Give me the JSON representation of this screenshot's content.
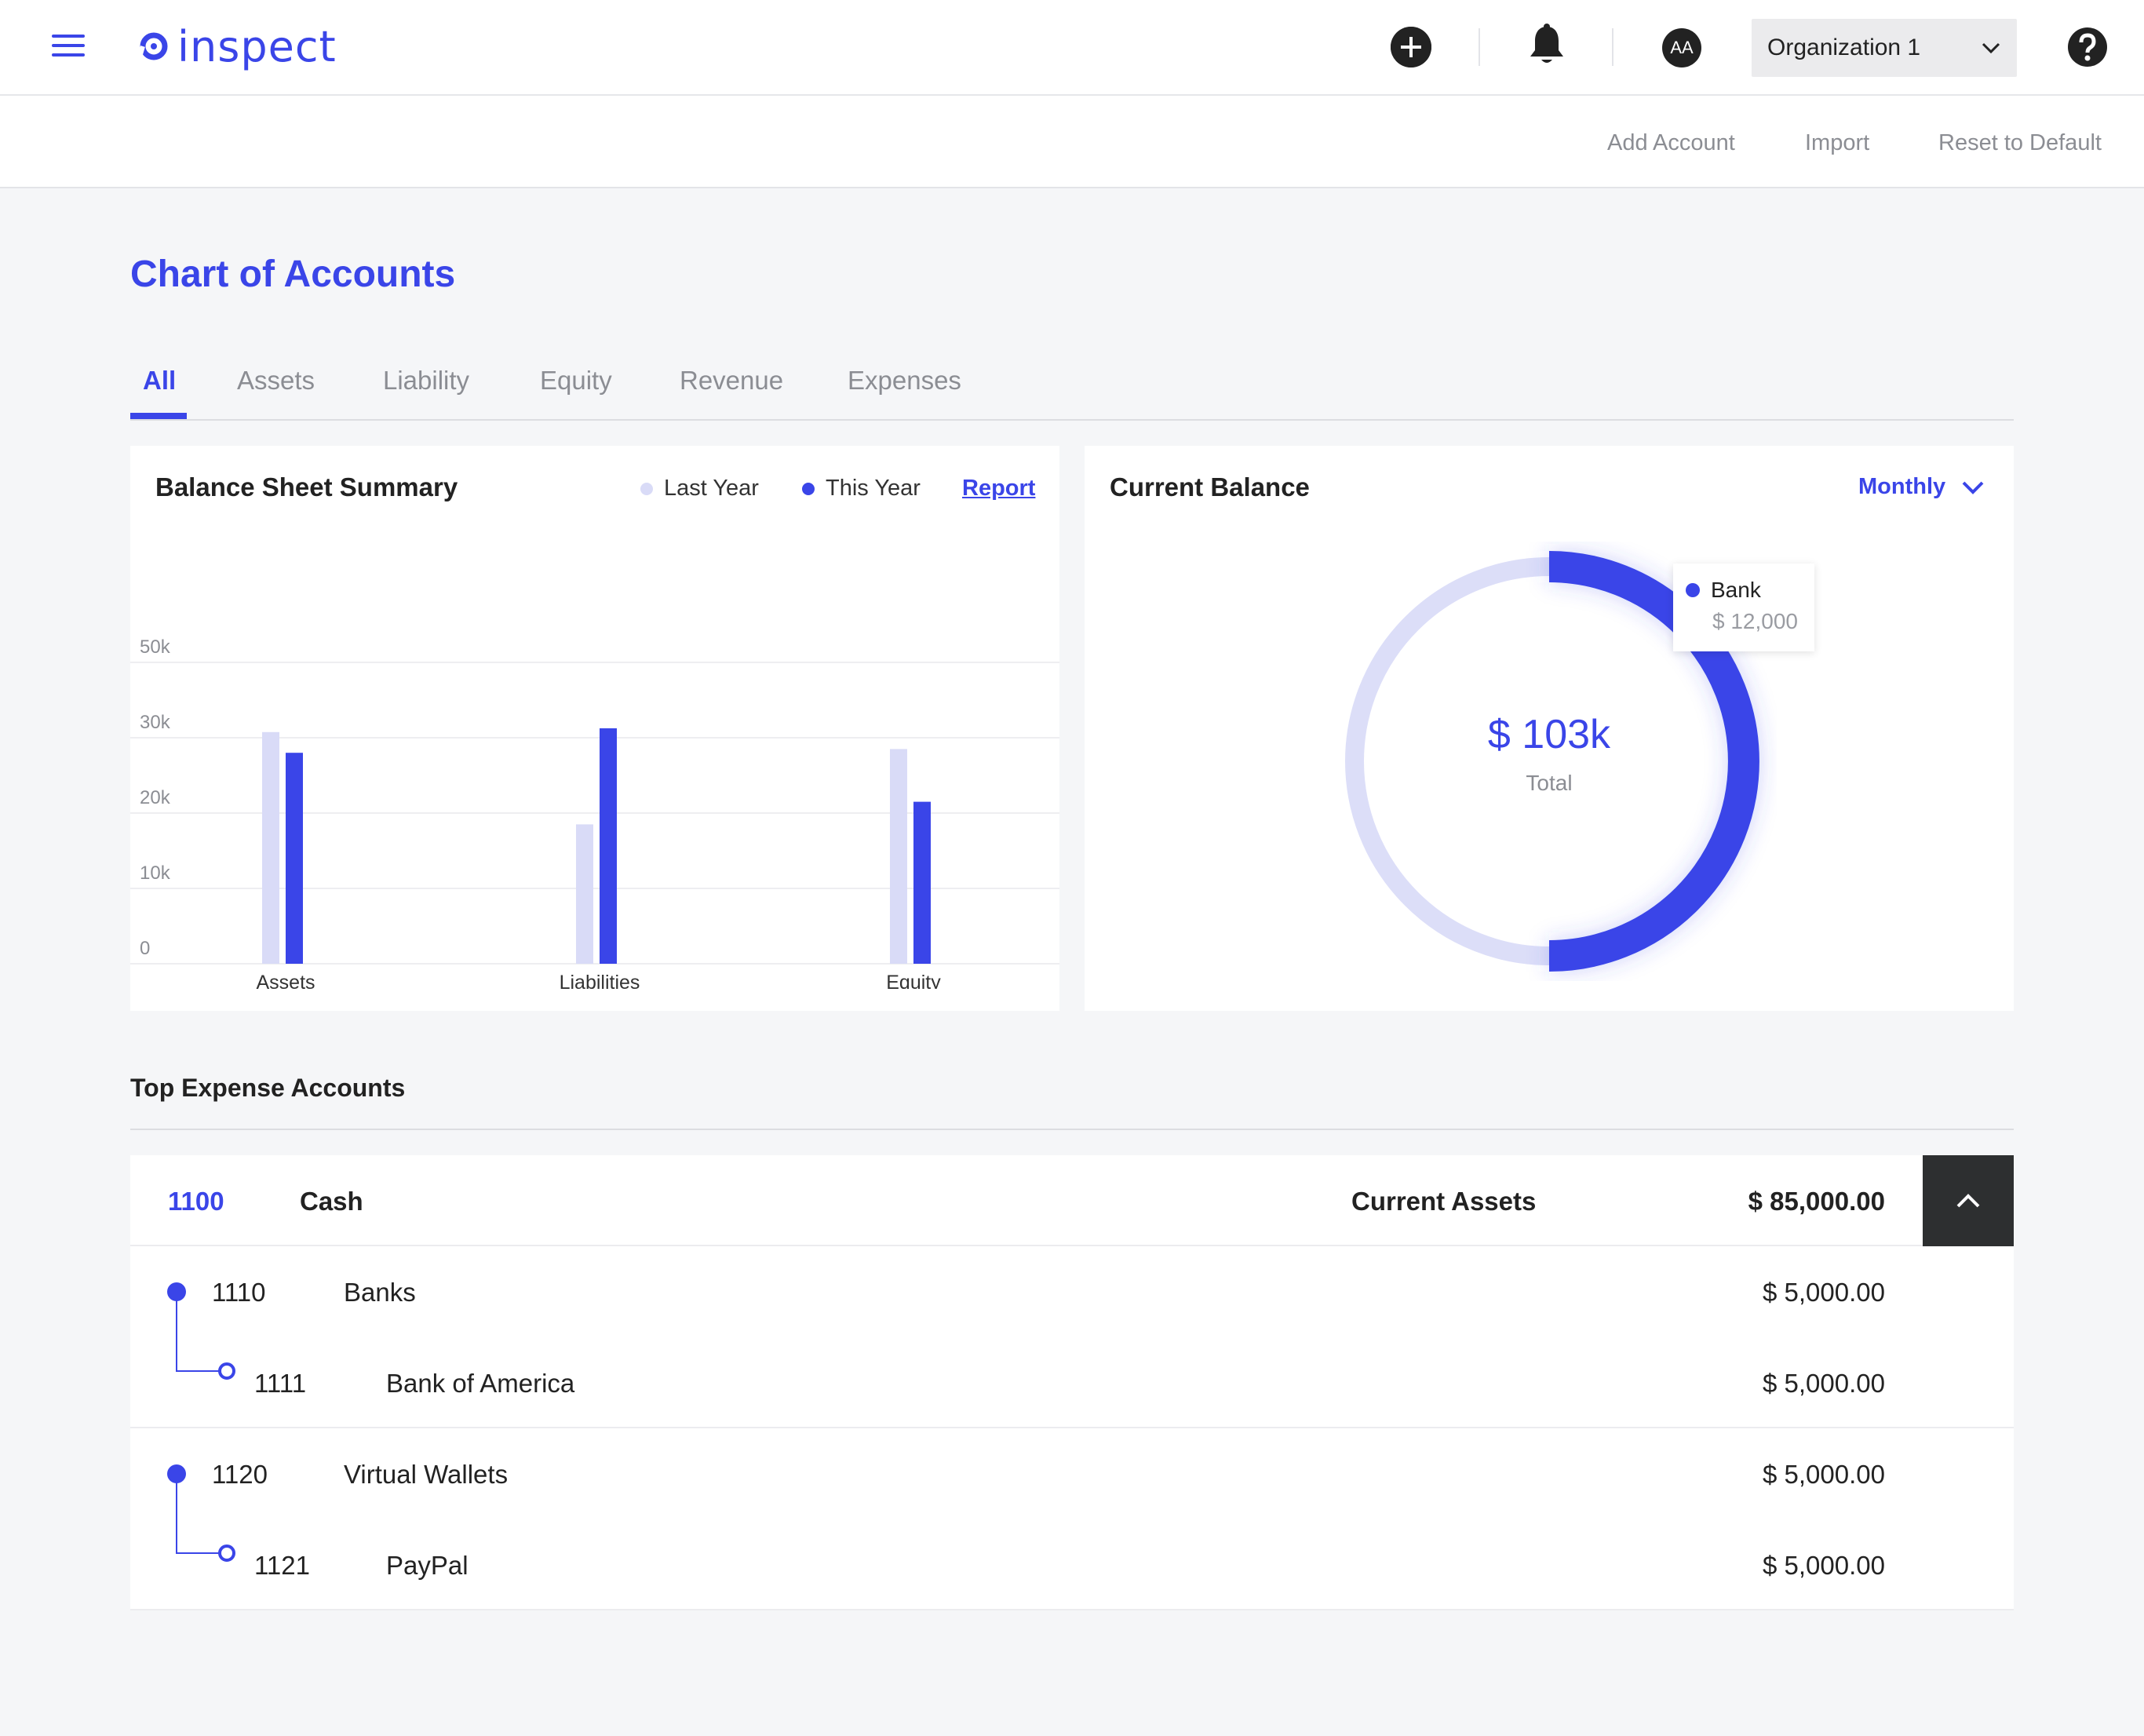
{
  "app": {
    "logo_text": "inspect",
    "brand_color": "#3a45e8"
  },
  "topbar": {
    "icons": [
      "menu-icon",
      "plus-icon",
      "bell-icon",
      "avatar",
      "chevron-down-icon",
      "help-icon"
    ],
    "avatar_initials": "AA",
    "org_name": "Organization 1"
  },
  "toolbar": {
    "add_account": "Add Account",
    "import": "Import",
    "reset": "Reset to Default"
  },
  "page": {
    "title": "Chart of Accounts",
    "tabs": [
      "All",
      "Assets",
      "Liability",
      "Equity",
      "Revenue",
      "Expenses"
    ],
    "active_tab": "All"
  },
  "balance_sheet": {
    "title": "Balance Sheet Summary",
    "legend": [
      {
        "label": "Last Year",
        "color": "#d9dbf7"
      },
      {
        "label": "This Year",
        "color": "#3a45e8"
      }
    ],
    "report_link": "Report"
  },
  "current_balance": {
    "title": "Current Balance",
    "period": "Monthly",
    "total_value": "$ 103k",
    "total_label": "Total",
    "tooltip_label": "Bank",
    "tooltip_value": "$ 12,000"
  },
  "chart_data": {
    "type": "bar",
    "categories": [
      "Assets",
      "Liabilities",
      "Equity"
    ],
    "series": [
      {
        "name": "Last Year",
        "values": [
          31500,
          18500,
          28500
        ],
        "color": "#d9dbf7"
      },
      {
        "name": "This Year",
        "values": [
          28000,
          32500,
          21500
        ],
        "color": "#3a45e8"
      }
    ],
    "yticks": [
      "50k",
      "30k",
      "20k",
      "10k",
      "0"
    ],
    "ylim": [
      0,
      50000
    ]
  },
  "expenses": {
    "title": "Top Expense Accounts",
    "header": {
      "code": "1100",
      "name": "Cash",
      "type": "Current Assets",
      "amount": "$ 85,000.00"
    },
    "groups": [
      {
        "parent": {
          "code": "1110",
          "name": "Banks",
          "amount": "$ 5,000.00"
        },
        "child": {
          "code": "1111",
          "name": "Bank of America",
          "amount": "$ 5,000.00"
        }
      },
      {
        "parent": {
          "code": "1120",
          "name": "Virtual Wallets",
          "amount": "$ 5,000.00"
        },
        "child": {
          "code": "1121",
          "name": "PayPal",
          "amount": "$ 5,000.00"
        }
      }
    ]
  }
}
